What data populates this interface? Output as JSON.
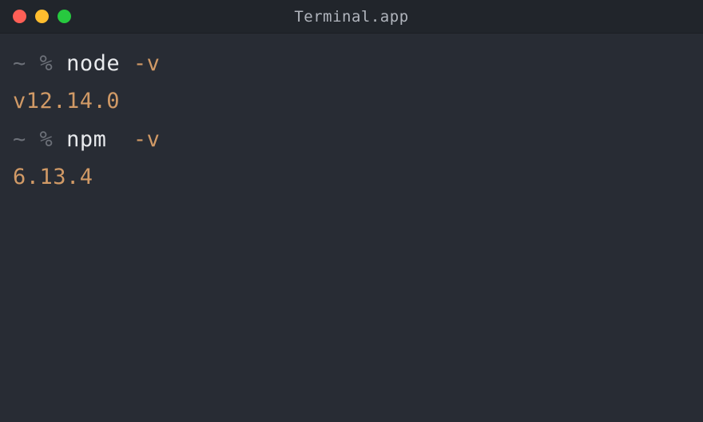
{
  "window": {
    "title": "Terminal.app"
  },
  "colors": {
    "close": "#ff5f56",
    "minimize": "#ffbd2e",
    "zoom": "#27c93f",
    "bg": "#282c34",
    "titlebar": "#21252b"
  },
  "prompt": {
    "tilde": "~",
    "symbol": "%"
  },
  "lines": {
    "cmd1_name": "node",
    "cmd1_flag": "-v",
    "out1": "v12.14.0",
    "cmd2_name": "npm",
    "cmd2_flag": "-v",
    "out2": "6.13.4"
  }
}
